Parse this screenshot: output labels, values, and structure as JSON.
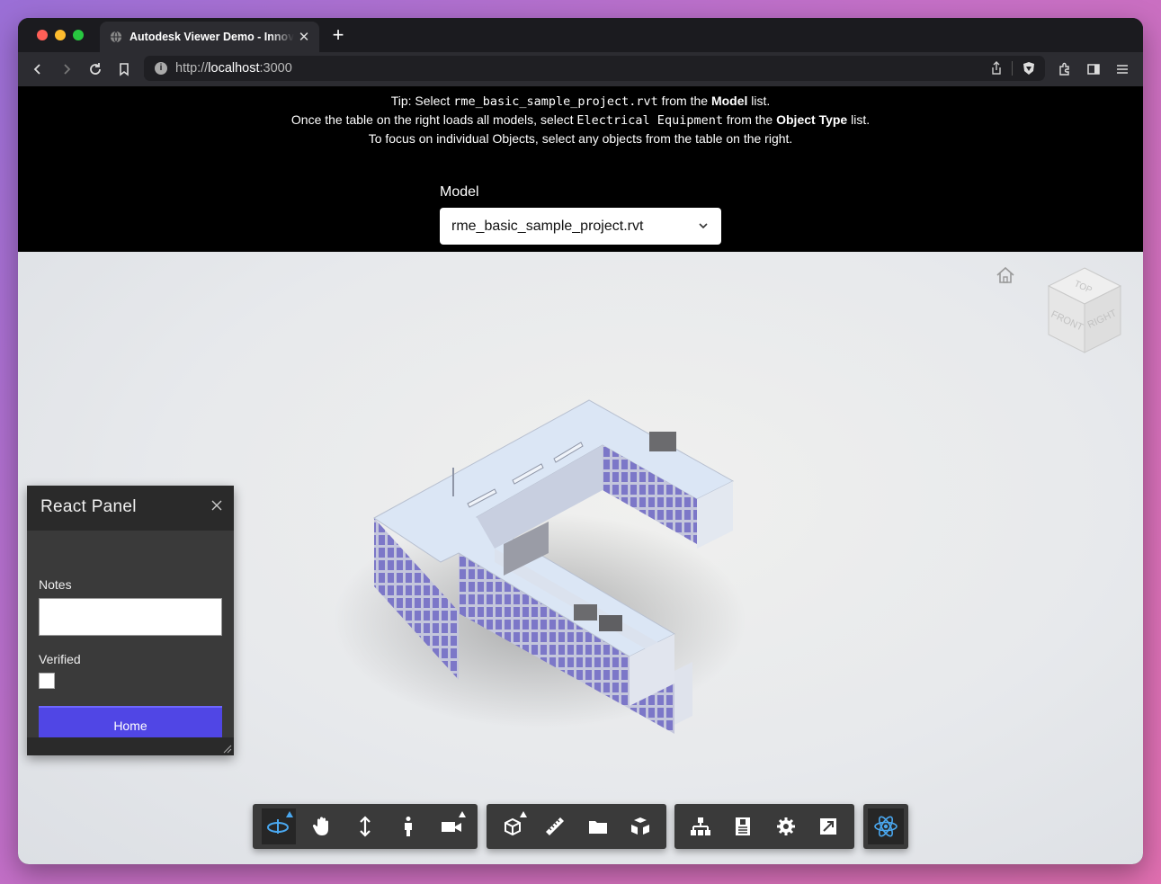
{
  "browser": {
    "tab_title": "Autodesk Viewer Demo - Innovation",
    "url_scheme": "http://",
    "url_host": "localhost",
    "url_port": ":3000"
  },
  "tips": {
    "line1_pre": "Tip: Select ",
    "line1_code": "rme_basic_sample_project.rvt",
    "line1_mid": " from the ",
    "line1_bold": "Model",
    "line1_post": " list.",
    "line2_pre": "Once the table on the right loads all models, select ",
    "line2_code": "Electrical Equipment",
    "line2_mid": " from the ",
    "line2_bold": "Object Type",
    "line2_post": " list.",
    "line3": "To focus on individual Objects, select any objects from the table on the right."
  },
  "model_select": {
    "label": "Model",
    "value": "rme_basic_sample_project.rvt"
  },
  "viewcube": {
    "top": "TOP",
    "front": "FRONT",
    "right": "RIGHT"
  },
  "panel": {
    "title": "React Panel",
    "notes_label": "Notes",
    "notes_value": "",
    "verified_label": "Verified",
    "verified": false,
    "home_button": "Home"
  },
  "toolbar": {
    "groups": [
      [
        "orbit-icon",
        "pan-icon",
        "zoom-icon",
        "first-person-icon",
        "camera-icon"
      ],
      [
        "section-icon",
        "measure-icon",
        "model-browser-icon",
        "explode-icon"
      ],
      [
        "structure-icon",
        "properties-icon",
        "settings-icon",
        "fullscreen-icon"
      ],
      [
        "react-icon"
      ]
    ],
    "accent_color": "#4aa8f0"
  }
}
